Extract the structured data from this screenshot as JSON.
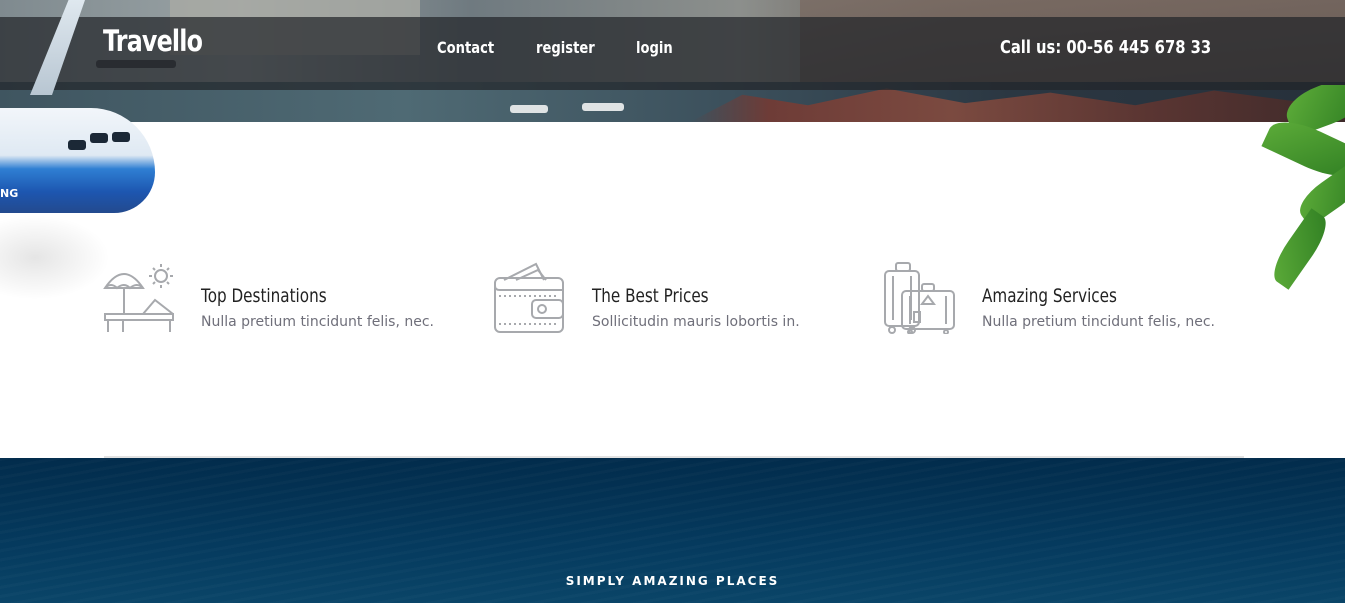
{
  "header": {
    "brand": "Travello",
    "nav": [
      {
        "label": "Contact"
      },
      {
        "label": "register"
      },
      {
        "label": "login"
      }
    ],
    "phone": "Call us: 00-56 445 678 33"
  },
  "decorations": {
    "plane_text": "NG"
  },
  "features": [
    {
      "icon": "beach-umbrella-icon",
      "title": "Top Destinations",
      "description": "Nulla pretium tincidunt felis, nec."
    },
    {
      "icon": "wallet-icon",
      "title": "The Best Prices",
      "description": "Sollicitudin mauris lobortis in."
    },
    {
      "icon": "luggage-icon",
      "title": "Amazing Services",
      "description": "Nulla pretium tincidunt felis, nec."
    }
  ],
  "section": {
    "kicker": "SIMPLY AMAZING PLACES"
  },
  "colors": {
    "icon_stroke": "#a7a9ad",
    "sea": "#033250",
    "navbar": "#23262a"
  }
}
